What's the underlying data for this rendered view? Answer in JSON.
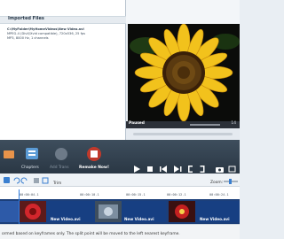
{
  "imported": {
    "title": "Imported Files",
    "file_path": "C:\\MyFolder\\MyHomeVideos\\New Video.avi",
    "file_video": "MPEG-4 (DivX/Xvid compatible), 720x536, 25 fps",
    "file_audio": "MP3, 8000 Hz, 1 channels"
  },
  "player": {
    "status": "Paused",
    "volume_value": "14"
  },
  "toolbar": {
    "chapters_label": "Chapters",
    "add_transitions_label": "Add Trans",
    "remake_label": "Remake Now!"
  },
  "timeline": {
    "trim_label": "Trim",
    "zoom_label": "Zoom:",
    "ticks": [
      "00:00:04.1",
      "00:00:10.1",
      "00:00:15.1",
      "00:00:12.1",
      "00:00:24.1"
    ],
    "clip_label": "New Video.avi"
  },
  "hint": {
    "text": "ormed based on keyframes only. The split point will be moved to the left nearest keyframe."
  },
  "colors": {
    "toolbar": "#2a3744",
    "track": "#1c3f7a",
    "accent": "#2f7de0"
  }
}
